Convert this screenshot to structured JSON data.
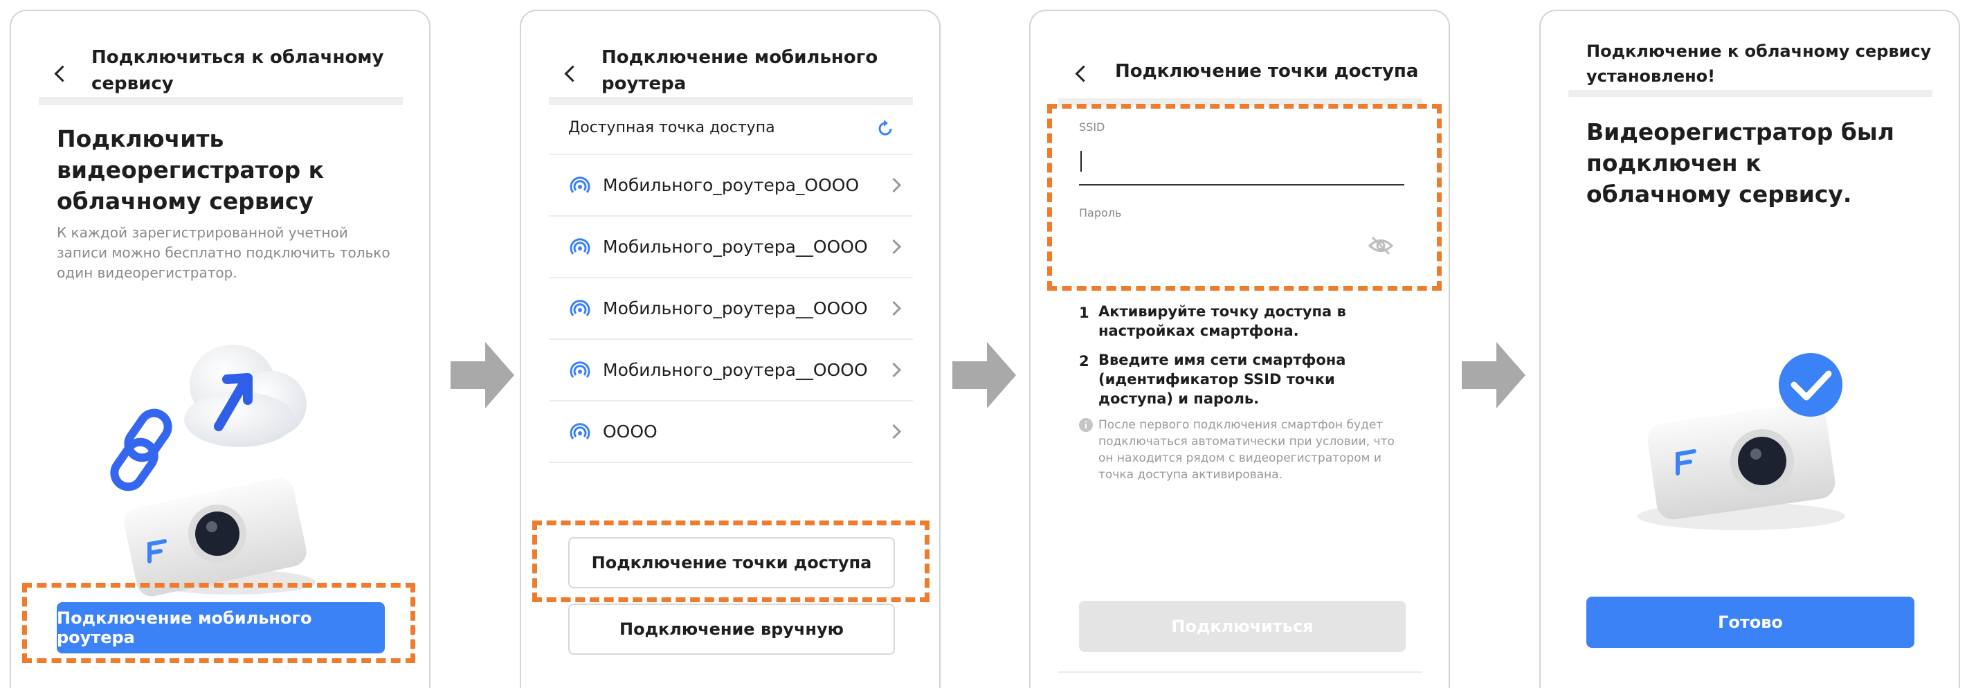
{
  "screen1": {
    "header_title": "Подключиться к облачному сервису",
    "title": "Подключить видеорегистратор к облачному сервису",
    "description": "К каждой зарегистрированной учетной записи можно бесплатно подключить только один видеорегистратор.",
    "button_label": "Подключение мобильного роутера",
    "icons": [
      "back-icon",
      "cloud-upload-icon",
      "chain-link-icon",
      "dashcam-icon"
    ]
  },
  "screen2": {
    "header_title": "Подключение мобильного роутера",
    "section_label": "Доступная точка доступа",
    "networks": [
      "Мобильного_роутера_OOOO",
      "Мобильного_роутера__OOOO",
      "Мобильного_роутера__OOOO",
      "Мобильного_роутера__OOOO",
      "OOOO"
    ],
    "hotspot_button_label": "Подключение точки доступа",
    "manual_button_label": "Подключение вручную",
    "icons": [
      "back-icon",
      "refresh-icon",
      "hotspot-icon",
      "chevron-right-icon"
    ]
  },
  "screen3": {
    "header_title": "Подключение точки доступа",
    "ssid_label": "SSID",
    "ssid_value": "",
    "password_label": "Пароль",
    "password_value": "",
    "steps": [
      {
        "num": "1",
        "text": "Активируйте точку доступа в настройках смартфона."
      },
      {
        "num": "2",
        "text": "Введите имя сети смартфона (идентификатор SSID точки доступа) и пароль."
      }
    ],
    "note": "После первого подключения смартфон будет подключаться автоматически при условии, что он находится рядом с видеорегистратором и точка доступа активирована.",
    "connect_button_label": "Подключиться",
    "icons": [
      "back-icon",
      "eye-off-icon",
      "info-icon"
    ]
  },
  "screen4": {
    "header_title": "Подключение к облачному сервису установлено!",
    "title": "Видеорегистратор был подключен к облачному сервису.",
    "done_button_label": "Готово",
    "icons": [
      "check-circle-icon",
      "dashcam-icon"
    ]
  },
  "colors": {
    "accent_blue": "#3b82f6",
    "highlight_orange": "#ef7c2c",
    "arrow_gray": "#a9a9a9",
    "disabled_gray": "#e4e4e4"
  }
}
